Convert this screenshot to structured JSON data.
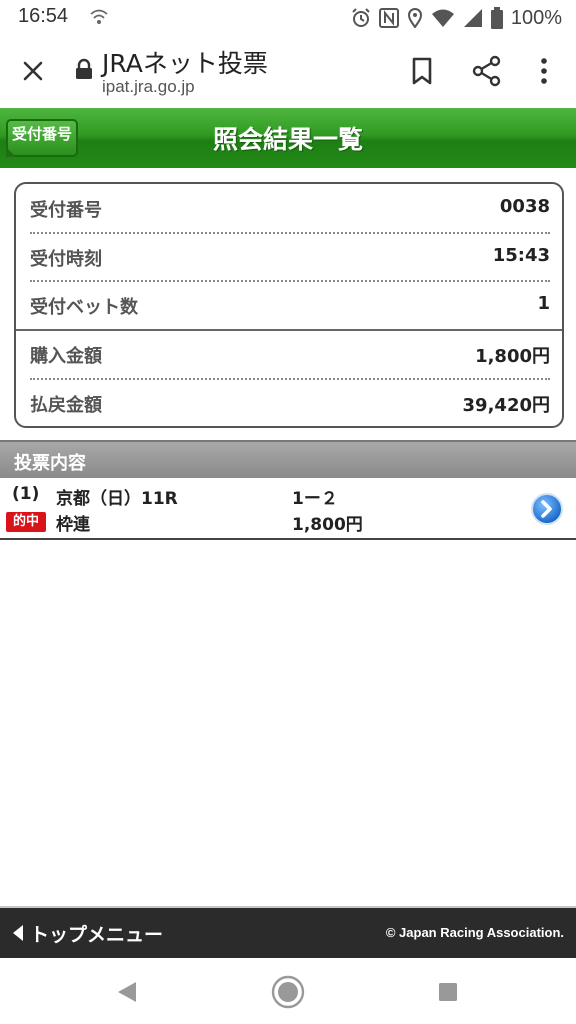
{
  "status_bar": {
    "time": "16:54",
    "battery": "100%",
    "icons": [
      "nfc-status-icon",
      "alarm-icon",
      "nfc-n-icon",
      "location-icon",
      "wifi-icon",
      "signal-icon",
      "battery-icon"
    ]
  },
  "browser": {
    "title": "JRAネット投票",
    "url": "ipat.jra.go.jp"
  },
  "header": {
    "back_label": "受付番号",
    "title": "照会結果一覧",
    "color": "#2f9a22"
  },
  "summary": {
    "rows": [
      {
        "label": "受付番号",
        "value": "0038"
      },
      {
        "label": "受付時刻",
        "value": "15:43"
      },
      {
        "label": "受付ベット数",
        "value": "1"
      },
      {
        "label": "購入金額",
        "value": "1,800円"
      },
      {
        "label": "払戻金額",
        "value": "39,420円"
      }
    ]
  },
  "bets": {
    "section_title": "投票内容",
    "items": [
      {
        "number": "(1)",
        "race": "京都（日）11R",
        "combination": "1ー２",
        "badge": "的中",
        "type": "枠連",
        "amount": "1,800円"
      }
    ],
    "badge_color": "#d8141a"
  },
  "footer": {
    "menu_label": "トップメニュー",
    "copyright": "© Japan Racing Association."
  }
}
